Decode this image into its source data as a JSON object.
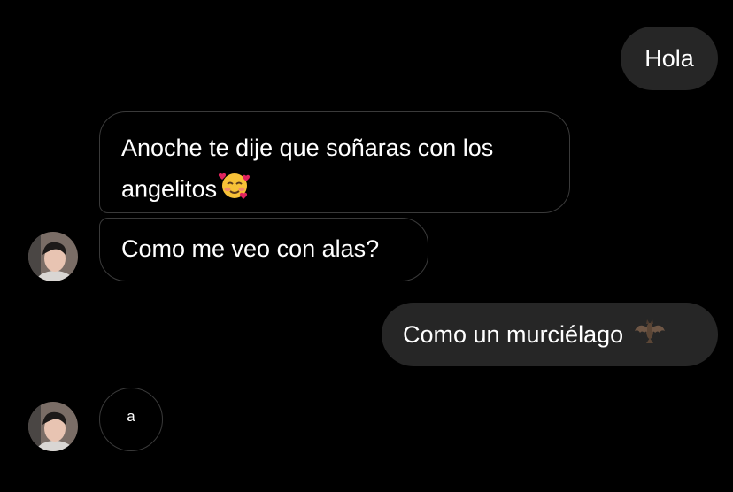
{
  "conversation": {
    "messages": [
      {
        "sender": "me",
        "text": "Hola"
      },
      {
        "sender": "them",
        "text_line1": "Anoche te dije que soñaras con los",
        "text_line2": "angelitos",
        "emoji": "smiling-face-with-hearts-emoji"
      },
      {
        "sender": "them",
        "text": "Como me veo con alas?"
      },
      {
        "sender": "me",
        "text": "Como un murciélago",
        "emoji": "bat-emoji"
      },
      {
        "sender": "them",
        "text": "a"
      }
    ]
  },
  "colors": {
    "background": "#000000",
    "outgoing_bubble": "#262626",
    "incoming_border": "#3a3a3a",
    "text": "#ffffff"
  }
}
